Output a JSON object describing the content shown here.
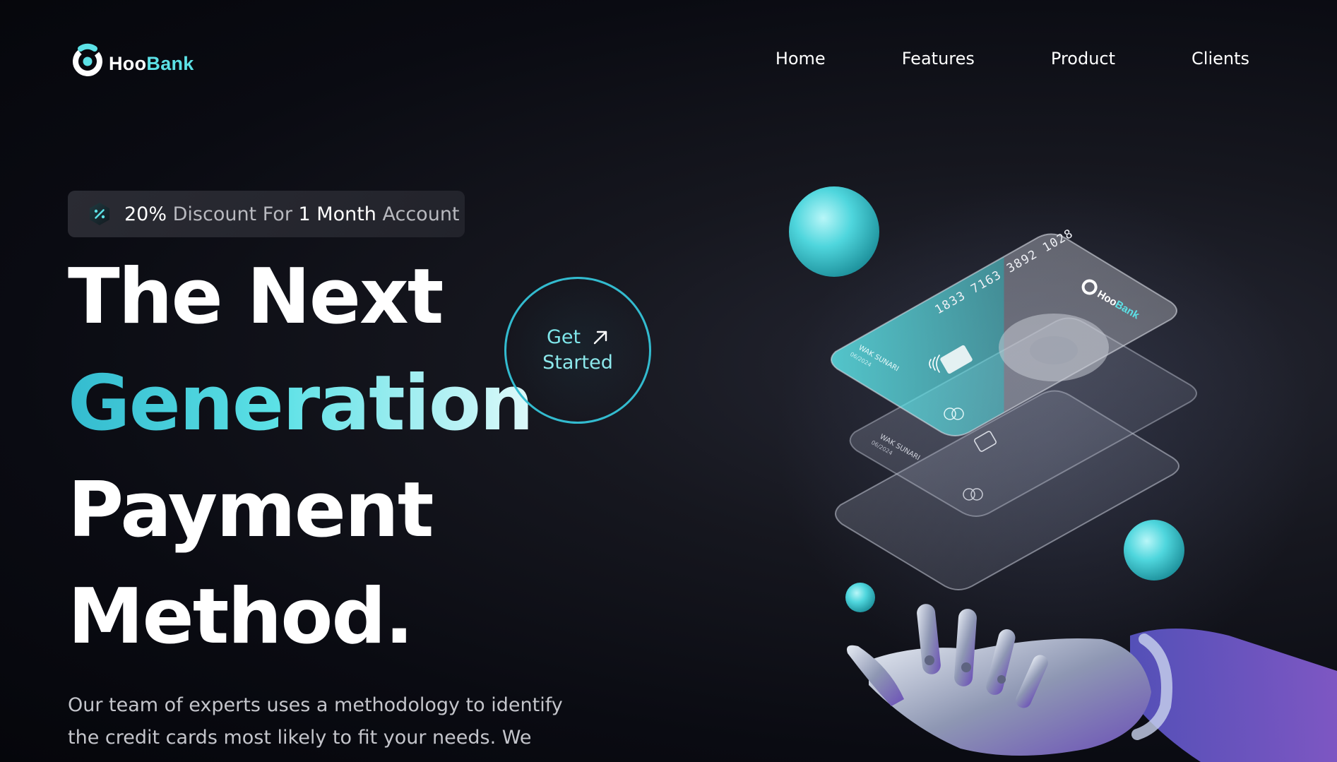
{
  "brand": {
    "name_part1": "Hoo",
    "name_part2": "Bank",
    "accent_color": "#5ce1e6",
    "icon": "hoobank-logo-icon"
  },
  "nav": {
    "items": [
      {
        "label": "Home"
      },
      {
        "label": "Features"
      },
      {
        "label": "Product"
      },
      {
        "label": "Clients"
      }
    ]
  },
  "discount": {
    "icon": "discount-percent-icon",
    "percent": "20%",
    "text1": "Discount For",
    "duration": "1 Month",
    "text2": "Account"
  },
  "hero": {
    "line1": "The Next",
    "line2": "Generation",
    "line3": "Payment",
    "line4": "Method.",
    "description": "Our team of experts uses a methodology to identify the credit cards most likely to fit your needs. We"
  },
  "cta": {
    "line1": "Get",
    "line2": "Started",
    "icon": "arrow-up-right-icon",
    "border_color": "#33bbcf"
  },
  "illustration": {
    "card_number": "1833 7163 3892 1028",
    "card_brand_1": "Hoo",
    "card_brand_2": "Bank",
    "card_holder": "WAK SUNARI",
    "card_expiry": "06/2024",
    "card_holder_2": "WAK SUNARI",
    "card_expiry_2": "06/2024"
  }
}
